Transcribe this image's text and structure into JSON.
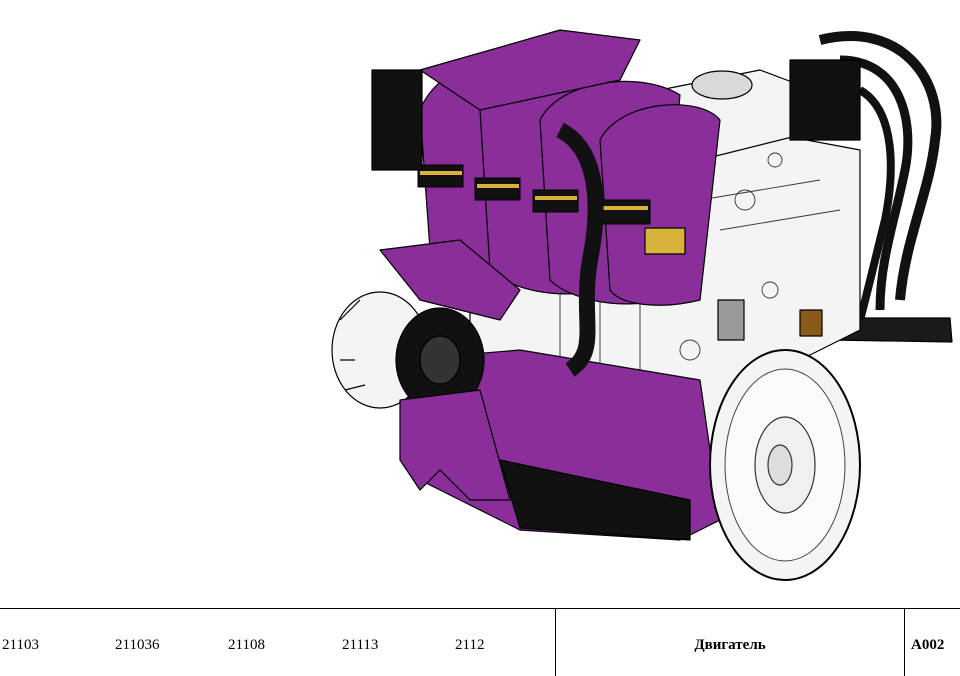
{
  "models": [
    "21103",
    "211036",
    "21108",
    "21113",
    "2112"
  ],
  "part_name": "Двигатель",
  "code": "A002",
  "colors": {
    "accent": "#8a2e99",
    "accent_dark": "#5e1a6c",
    "hose": "#1a1a1a",
    "band": "#d8b23a",
    "metal": "#f4f4f4"
  }
}
